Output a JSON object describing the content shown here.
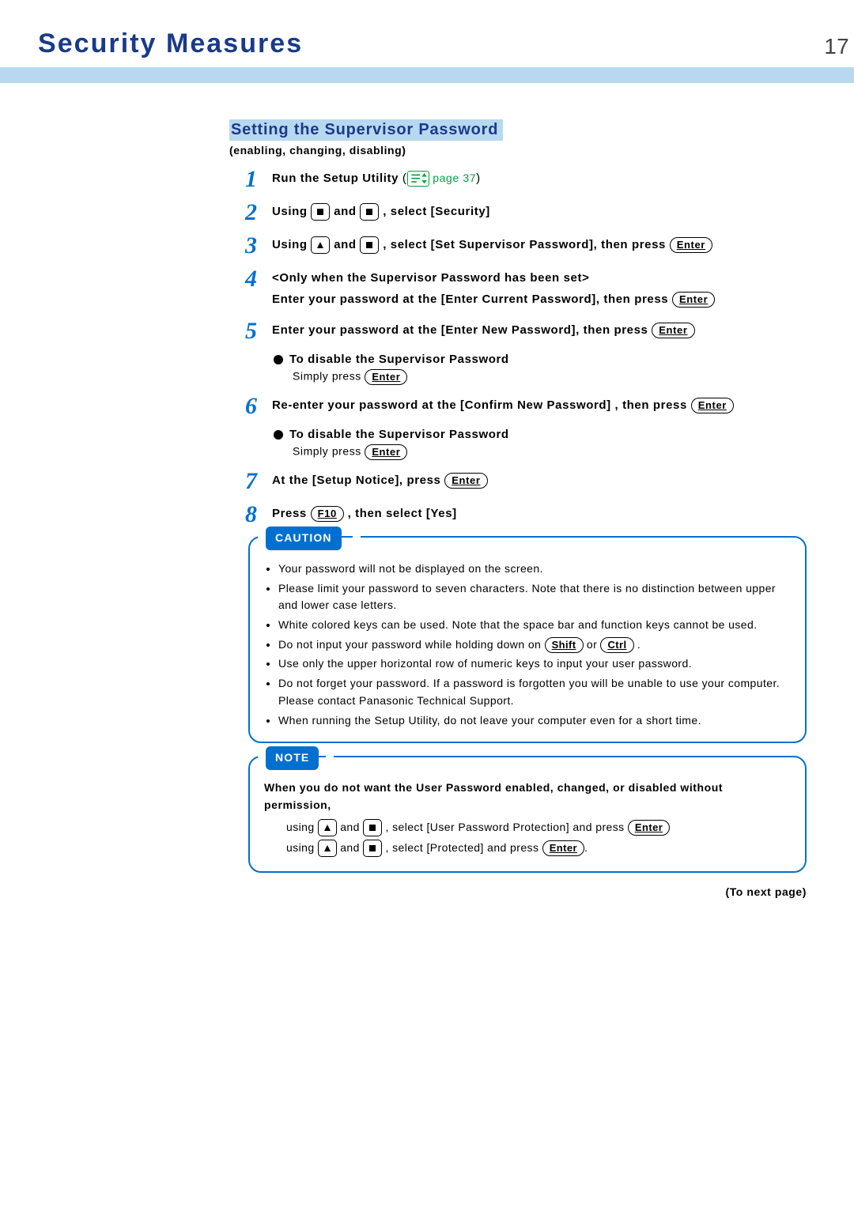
{
  "page": {
    "title": "Security Measures",
    "number": "17",
    "to_next": "(To next page)"
  },
  "section": {
    "heading": "Setting the Supervisor Password",
    "sub": "(enabling, changing, disabling)"
  },
  "keys": {
    "enter": "Enter",
    "f10": "F10",
    "shift": "Shift",
    "ctrl": "Ctrl"
  },
  "ref": {
    "page37": "page 37"
  },
  "steps": {
    "s1_a": "Run the Setup Utility",
    "s1_paren_open": "(",
    "s1_paren_close": ")",
    "s2_a": "Using ",
    "s2_b": " and ",
    "s2_c": " , select [Security]",
    "s3_a": "Using ",
    "s3_b": " and ",
    "s3_c": " , select [Set Supervisor Password], then press ",
    "s4_a": "<Only when the Supervisor Password has been set>",
    "s4_b": "Enter your password at the [Enter Current Password], then press  ",
    "s5_a": "Enter your password at the [Enter New Password], then press  ",
    "disable_heading": "To disable the Supervisor Password",
    "disable_text": "Simply press ",
    "s6_a": "Re-enter your password at the [Confirm New Password] , then press  ",
    "s7_a": "At the [Setup Notice], press  ",
    "s8_a": "Press ",
    "s8_b": " , then select [Yes]"
  },
  "step_nums": {
    "n1": "1",
    "n2": "2",
    "n3": "3",
    "n4": "4",
    "n5": "5",
    "n6": "6",
    "n7": "7",
    "n8": "8"
  },
  "caution": {
    "label": "CAUTION",
    "c1": "Your password will not be displayed on the screen.",
    "c2": "Please limit your password to seven characters.  Note that there is no distinction between upper and lower case letters.",
    "c3": "White colored keys can be used.  Note that the space bar and function keys cannot be used.",
    "c4_a": "Do not input your password while holding down on ",
    "c4_b": " or  ",
    "c4_c": " .",
    "c5": "Use only the upper horizontal row of numeric keys to input your user password.",
    "c6": "Do not forget your password.  If a password is forgotten you will be unable to use your computer.  Please contact Panasonic Technical Support.",
    "c7": "When running the Setup Utility, do not leave your computer even for a short time."
  },
  "note": {
    "label": "NOTE",
    "heading": "When you do not want the User Password enabled, changed, or disabled without permission,",
    "l1_a": "using ",
    "l1_b": " and ",
    "l1_c": " , select [User Password Protection] and press ",
    "l2_a": "using ",
    "l2_b": " and ",
    "l2_c": " , select [Protected] and press ",
    "period": "."
  }
}
